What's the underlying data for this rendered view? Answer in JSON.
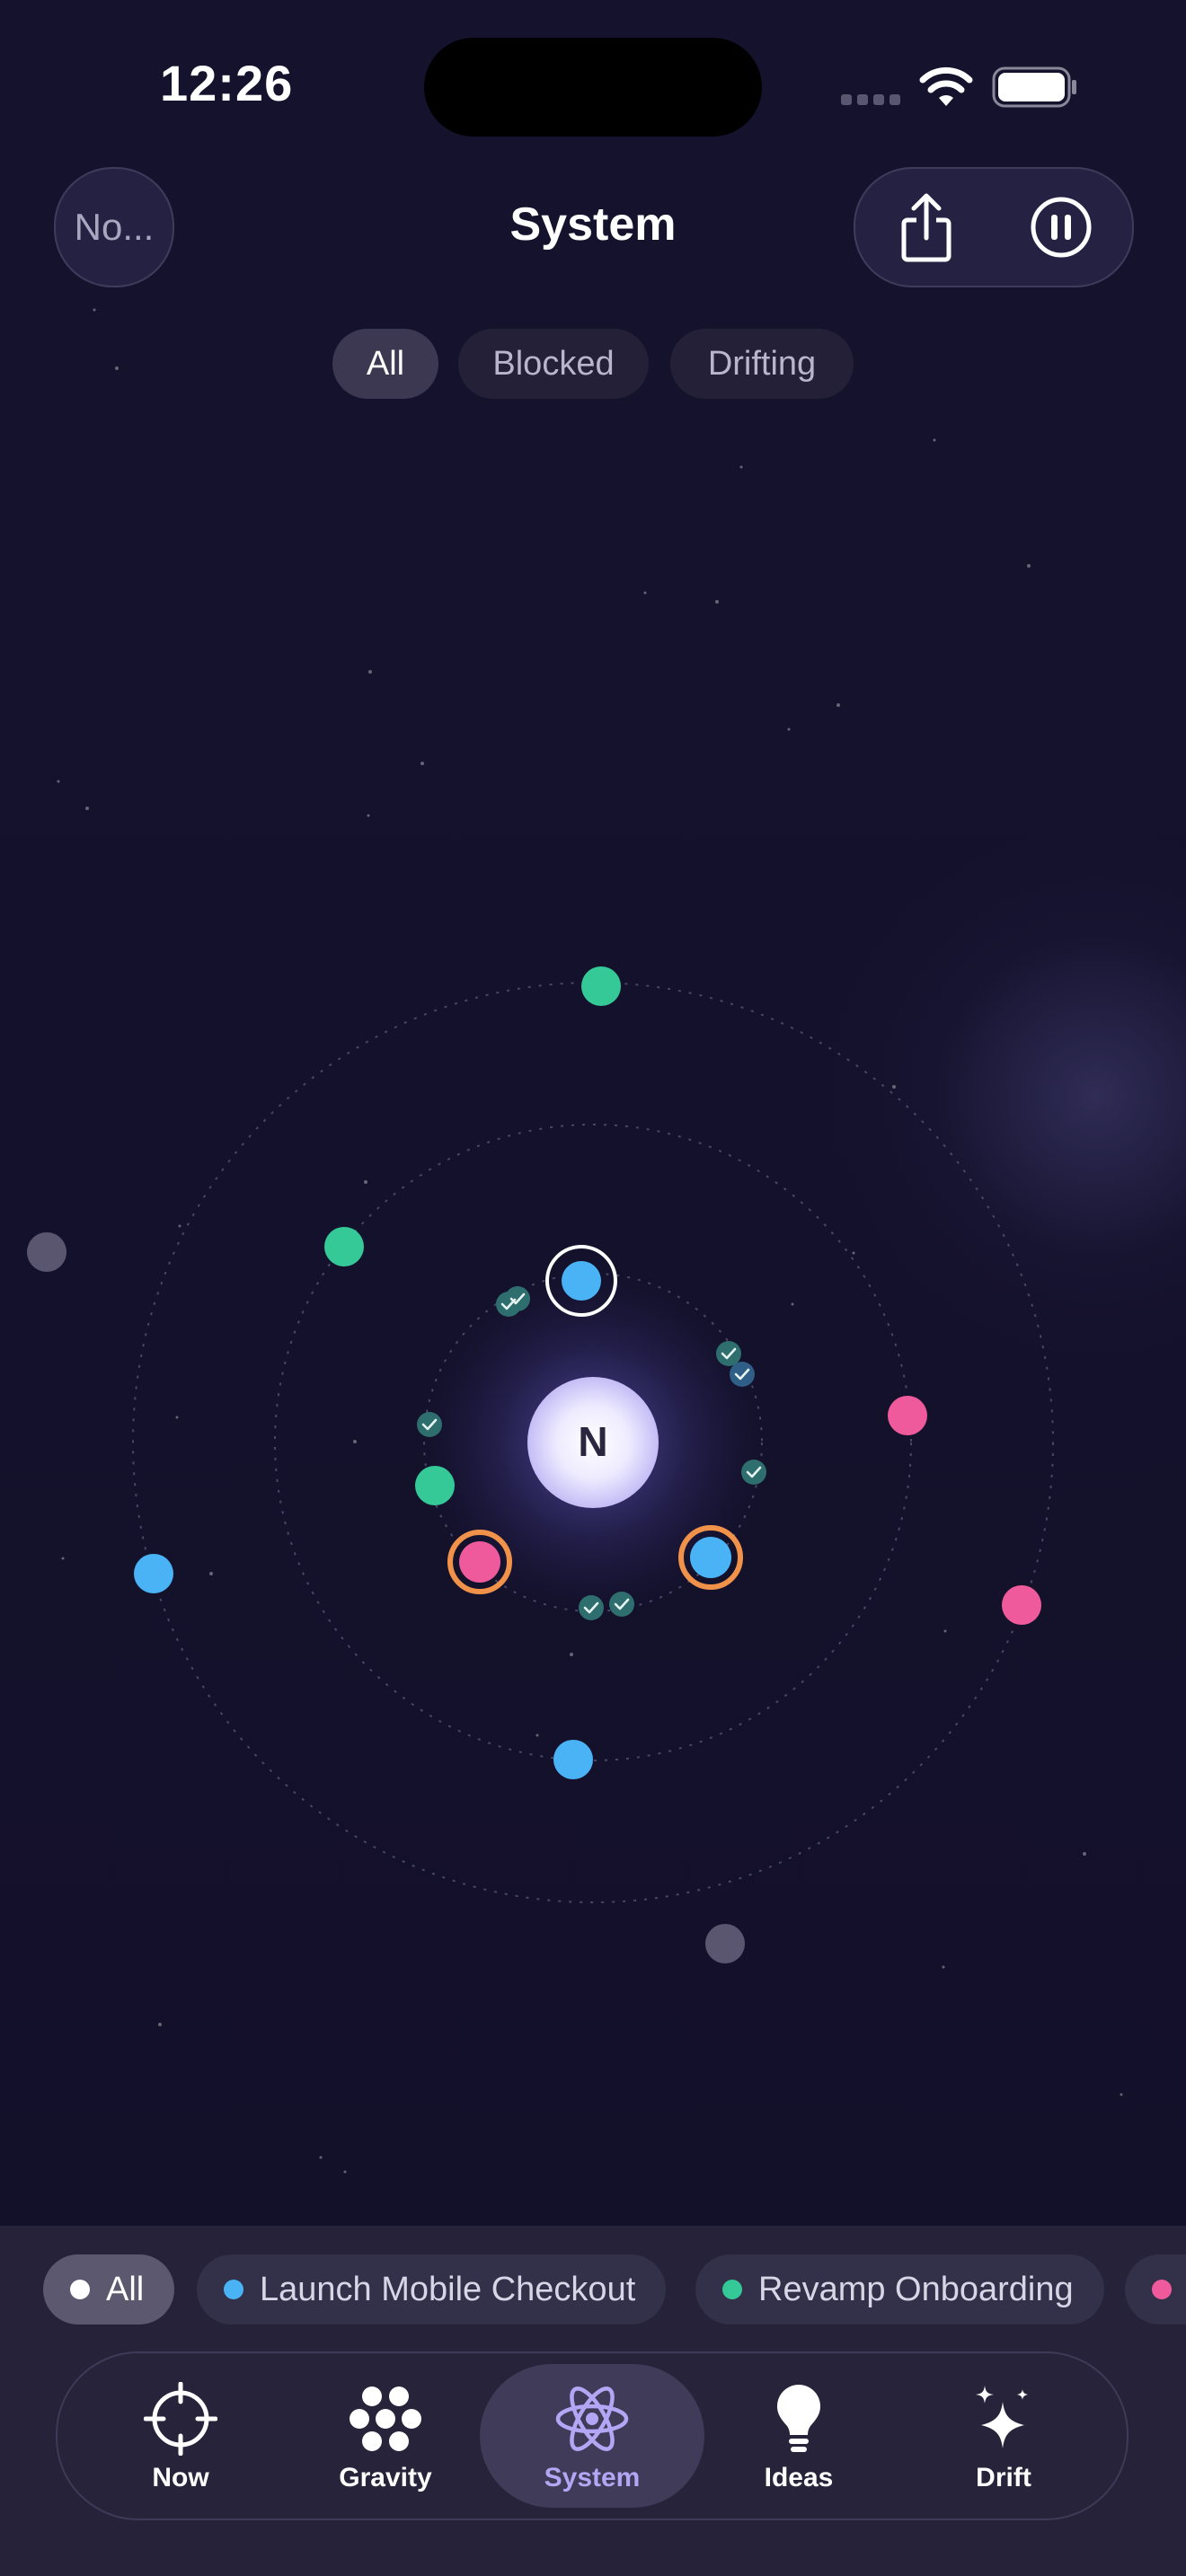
{
  "status": {
    "time": "12:26"
  },
  "header": {
    "back_label": "No...",
    "title": "System",
    "share_icon": "share-icon",
    "pause_icon": "pause-icon"
  },
  "filters": [
    {
      "label": "All",
      "active": true
    },
    {
      "label": "Blocked",
      "active": false
    },
    {
      "label": "Drifting",
      "active": false
    }
  ],
  "center": {
    "label": "N"
  },
  "colors": {
    "blue": "#4ab3f5",
    "green": "#34c997",
    "pink": "#ee5a9b",
    "gray": "#5a5670",
    "orange": "#f0924a"
  },
  "projects": [
    {
      "label": "All",
      "dot": "#ffffff",
      "active": true
    },
    {
      "label": "Launch Mobile Checkout",
      "dot": "#4ab3f5",
      "active": false
    },
    {
      "label": "Revamp Onboarding",
      "dot": "#34c997",
      "active": false
    },
    {
      "label": "",
      "dot": "#ee5a9b",
      "active": false
    }
  ],
  "tabs": [
    {
      "label": "Now",
      "icon": "crosshair-icon",
      "active": false
    },
    {
      "label": "Gravity",
      "icon": "gravity-dots-icon",
      "active": false
    },
    {
      "label": "System",
      "icon": "atom-icon",
      "active": true
    },
    {
      "label": "Ideas",
      "icon": "lightbulb-icon",
      "active": false
    },
    {
      "label": "Drift",
      "icon": "sparkles-icon",
      "active": false
    }
  ]
}
